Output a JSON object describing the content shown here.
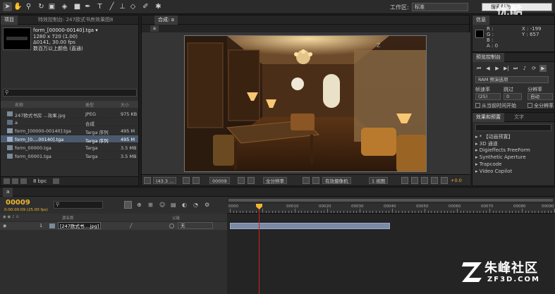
{
  "toolbar": {
    "workspace_label": "工作区:",
    "workspace_value": "标准",
    "search_placeholder": "搜索帮助"
  },
  "project_panel": {
    "tabs": [
      "项目",
      "特效控制台: 247欧式书房效果图8"
    ],
    "selected_item": "form_[00000-00140].tga ▾",
    "info_lines": [
      "1280 x 720 (1.00)",
      "Δ0141, 30.00 fps",
      "数百万以上颜色 (直通)"
    ],
    "headers": {
      "name": "名称",
      "type": "类型",
      "size": "大小"
    },
    "rows": [
      {
        "name": "247欧式书房 ...效果.jpg",
        "type": "JPEG",
        "size": "975 KB"
      },
      {
        "name": "a",
        "type": "合成",
        "size": ""
      },
      {
        "name": "form_[00000-00140].tga",
        "type": "Targa 序列",
        "size": "495 M"
      },
      {
        "name": "form_[0....00140].tga",
        "type": "Targa 序列",
        "size": "495 M"
      },
      {
        "name": "form_00000.tga",
        "type": "Targa",
        "size": "3.5 MB"
      },
      {
        "name": "form_00001.tga",
        "type": "Targa",
        "size": "3.5 MB"
      }
    ],
    "footer_bpc": "8 bpc"
  },
  "comp_panel": {
    "tab_label": "合成: a",
    "sub_tab": "a",
    "controls": {
      "zoom": "(43.3 ...",
      "timecode": "00009",
      "resolution": "全分辨率",
      "camera": "有效摄像机",
      "views": "1 视图",
      "exposure": "+0.0"
    }
  },
  "info_panel": {
    "tab": "信息",
    "rgb": [
      "R :",
      "G :",
      "B :",
      "A : 0"
    ],
    "coords": [
      "X : -199",
      "Y : 657"
    ]
  },
  "preview_panel": {
    "tab": "预览控制台",
    "ram_preview": "RAM 预演选项",
    "frame_rate_label": "帧速率",
    "skip_label": "跳过",
    "resolution_label": "分辨率",
    "frame_rate_value": "(25)",
    "skip_value": "0",
    "resolution_value": "自动",
    "from_current": "从当前时间开始",
    "full_screen": "全分辨率"
  },
  "effects_panel": {
    "tabs": [
      "效果和预置",
      "文字"
    ],
    "items": [
      "* 【动画预置】",
      "3D 通道",
      "Digieffects FreeForm",
      "Synthetic Aperture",
      "Trapcode",
      "Video Copilot"
    ]
  },
  "timeline": {
    "tab": "a",
    "timecode": "00009",
    "timecode_sub": "0:00:00:09 (25.00 fps)",
    "search_placeholder": "",
    "col_source": "源名称",
    "col_parent": "父级",
    "layer_index": "1",
    "layer_name": "[247欧式书....jpg]",
    "layer_parent": "无",
    "ruler_labels": [
      "0000",
      "00010",
      "00020",
      "00030",
      "00040",
      "00050",
      "00060",
      "00070",
      "00080",
      "00090"
    ]
  },
  "watermarks": {
    "top_right": "优酷",
    "bottom_right_zh": "朱峰社区",
    "bottom_right_en": "ZF3D.COM"
  },
  "colors": {
    "accent_timecode": "#f0b630",
    "selection": "#4b5a6e",
    "layer_bar": "#7b8aa6",
    "playhead": "#d02020"
  }
}
